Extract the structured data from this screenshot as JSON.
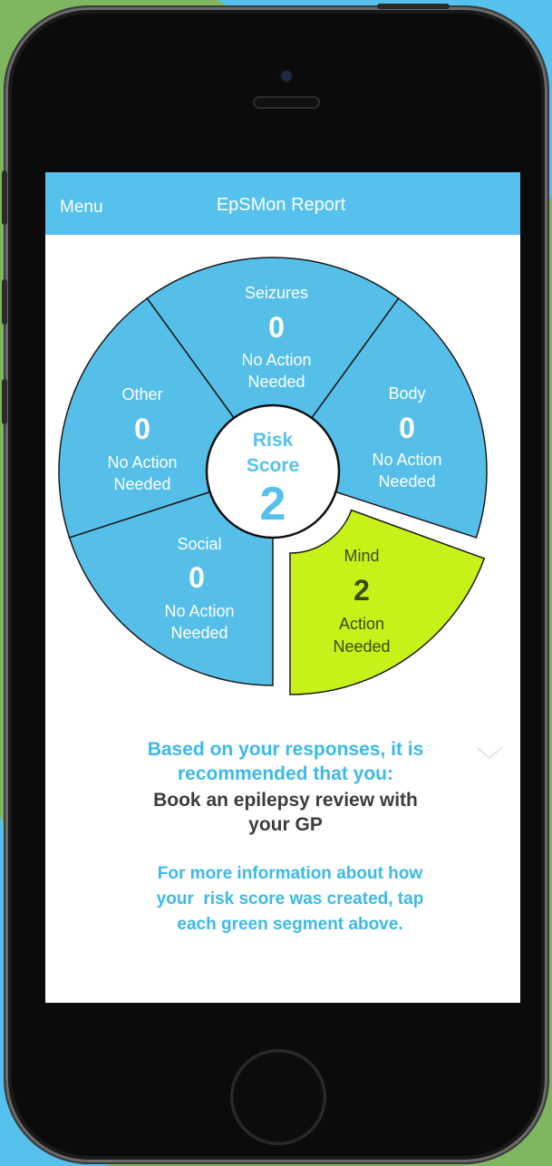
{
  "navbar": {
    "menu_label": "Menu",
    "title": "EpSMon Report"
  },
  "risk": {
    "label_line1": "Risk",
    "label_line2": "Score",
    "value": "2"
  },
  "segments": {
    "seizures": {
      "name": "Seizures",
      "score": "0",
      "status_line1": "No Action",
      "status_line2": "Needed",
      "color": "#55bfea"
    },
    "body": {
      "name": "Body",
      "score": "0",
      "status_line1": "No Action",
      "status_line2": "Needed",
      "color": "#55bfea"
    },
    "mind": {
      "name": "Mind",
      "score": "2",
      "status_line1": "Action",
      "status_line2": "Needed",
      "color": "#c6f21a"
    },
    "social": {
      "name": "Social",
      "score": "0",
      "status_line1": "No Action",
      "status_line2": "Needed",
      "color": "#55bfea"
    },
    "other": {
      "name": "Other",
      "score": "0",
      "status_line1": "No Action",
      "status_line2": "Needed",
      "color": "#55bfea"
    }
  },
  "recommendation": {
    "intro_line1": "Based on your responses, it is",
    "intro_line2": "recommended that you:",
    "action_line1": "Book an epilepsy review with",
    "action_line2": "your GP"
  },
  "info": {
    "line1": "For more information about how",
    "line2": "your  risk score was created, tap",
    "line3": "each green segment above."
  },
  "colors": {
    "accent": "#55c1ec",
    "text_blue": "#3cb9ea",
    "action_green": "#c6f21a",
    "background_green": "#7fb760"
  }
}
